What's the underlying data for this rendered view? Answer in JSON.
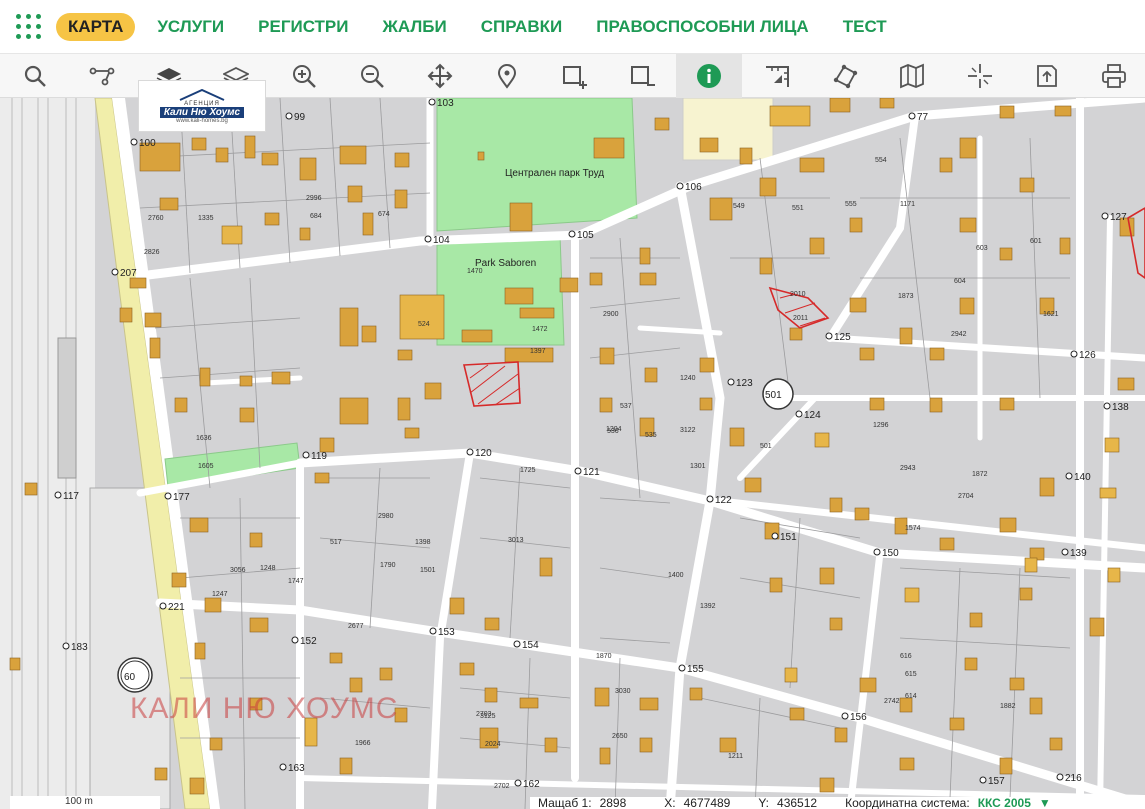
{
  "nav": {
    "items": [
      {
        "label": "КАРТА",
        "active": true
      },
      {
        "label": "УСЛУГИ"
      },
      {
        "label": "РЕГИСТРИ"
      },
      {
        "label": "ЖАЛБИ"
      },
      {
        "label": "СПРАВКИ"
      },
      {
        "label": "ПРАВОСПОСОБНИ ЛИЦА"
      },
      {
        "label": "ТЕСТ"
      }
    ]
  },
  "toolbar": {
    "tools": [
      "search-icon",
      "route-icon",
      "layers-filled-icon",
      "layers-outline-icon",
      "zoom-in-icon",
      "zoom-out-icon",
      "pan-icon",
      "location-pin-icon",
      "add-area-icon",
      "remove-area-icon",
      "info-icon",
      "measure-icon",
      "polygon-icon",
      "map-icon",
      "crosshair-icon",
      "export-icon",
      "print-icon"
    ],
    "active_tool": "info-icon"
  },
  "logo": {
    "line1": "АГЕНЦИЯ",
    "line2": "Кали Ню Хоумс",
    "line3": "www.kali-homes.bg"
  },
  "map": {
    "watermark": "КАЛИ НЮ ХОУМС",
    "park_label_1": "Централен парк Труд",
    "park_label_2": "Park Saboren",
    "points": [
      {
        "label": "100"
      },
      {
        "label": "99"
      },
      {
        "label": "103"
      },
      {
        "label": "104"
      },
      {
        "label": "105"
      },
      {
        "label": "106"
      },
      {
        "label": "77"
      },
      {
        "label": "127"
      },
      {
        "label": "207"
      },
      {
        "label": "125"
      },
      {
        "label": "126"
      },
      {
        "label": "123"
      },
      {
        "label": "124"
      },
      {
        "label": "138"
      },
      {
        "label": "119"
      },
      {
        "label": "120"
      },
      {
        "label": "121"
      },
      {
        "label": "122"
      },
      {
        "label": "140"
      },
      {
        "label": "117"
      },
      {
        "label": "177"
      },
      {
        "label": "151"
      },
      {
        "label": "150"
      },
      {
        "label": "139"
      },
      {
        "label": "221"
      },
      {
        "label": "152"
      },
      {
        "label": "153"
      },
      {
        "label": "154"
      },
      {
        "label": "155"
      },
      {
        "label": "183"
      },
      {
        "label": "156"
      },
      {
        "label": "163"
      },
      {
        "label": "157"
      },
      {
        "label": "216"
      },
      {
        "label": "162"
      }
    ],
    "parcels": [
      "1335",
      "2996",
      "684",
      "674",
      "1470",
      "524",
      "1397",
      "1472",
      "2900",
      "1240",
      "3122",
      "537",
      "2010",
      "2011",
      "501",
      "1301",
      "2704",
      "1574",
      "2980",
      "3013",
      "517",
      "1790",
      "1398",
      "1501",
      "1400",
      "1392",
      "1870",
      "2677",
      "3030",
      "2650",
      "3125",
      "2024",
      "1211",
      "1882",
      "2703",
      "2702",
      "1636",
      "1605",
      "1725",
      "1204",
      "1171",
      "1873",
      "1621",
      "2942",
      "2943",
      "1872",
      "1296",
      "536",
      "535",
      "549",
      "551",
      "555",
      "554",
      "601",
      "603",
      "604",
      "616",
      "615",
      "614",
      "2742",
      "1966",
      "1247",
      "3056",
      "1248",
      "1747",
      "2826",
      "2760"
    ],
    "circle_labels": [
      "501",
      "60"
    ]
  },
  "scale": {
    "label": "100 m"
  },
  "status": {
    "scale_label": "Мащаб 1:",
    "scale_value": "2898",
    "x_label": "X:",
    "x_value": "4677489",
    "y_label": "Y:",
    "y_value": "436512",
    "coord_label": "Координатна система:",
    "coord_value": "ККС 2005"
  },
  "colors": {
    "nav_green": "#1e9a55",
    "active_yellow": "#f6c445",
    "building": "#d9a23c",
    "parcel": "#d2d2d4",
    "street": "#ffffff",
    "park": "#a8e8a6",
    "rail_yellow": "#f1eeaa",
    "highlight_red": "#d62a2a"
  }
}
